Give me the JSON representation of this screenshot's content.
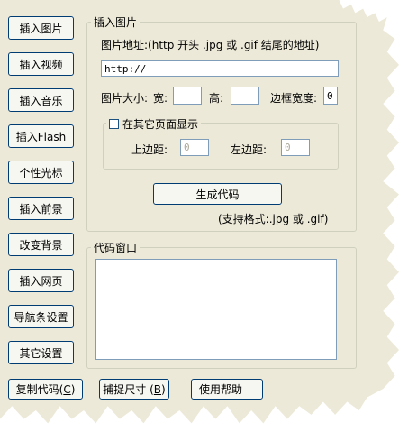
{
  "sidebar": {
    "buttons": [
      "插入图片",
      "插入视频",
      "插入音乐",
      "插入Flash",
      "个性光标",
      "插入前景",
      "改变背景",
      "插入网页",
      "导航条设置",
      "其它设置"
    ]
  },
  "image_group": {
    "legend": "插入图片",
    "address_label": "图片地址:(http 开头 .jpg 或 .gif 结尾的地址)",
    "url_value": "http://",
    "size_label": "图片大小:",
    "width_label": "宽:",
    "width_value": "",
    "height_label": "高:",
    "height_value": "",
    "border_label": "边框宽度:",
    "border_value": "0",
    "other_page_label": "在其它页面显示",
    "other_page_checked": false,
    "top_margin_label": "上边距:",
    "top_margin_value": "0",
    "left_margin_label": "左边距:",
    "left_margin_value": "0",
    "generate_button": "生成代码",
    "formats_note": "(支持格式:.jpg 或 .gif)"
  },
  "code_group": {
    "legend": "代码窗口",
    "code_value": ""
  },
  "footer": {
    "copy_button": "复制代码",
    "copy_key": "C",
    "capture_button": "捕捉尺寸",
    "capture_key": "B",
    "help_button": "使用帮助"
  }
}
